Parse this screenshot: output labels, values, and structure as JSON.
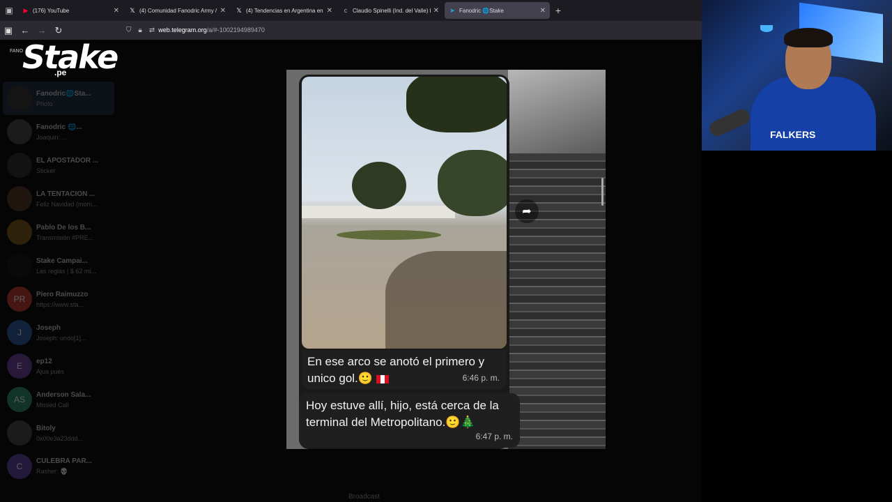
{
  "tabs": [
    {
      "title": "(176) YouTube",
      "icon": "youtube-icon",
      "active": false
    },
    {
      "title": "(4) Comunidad Fanodric Army /",
      "icon": "x-icon",
      "active": false
    },
    {
      "title": "(4) Tendencias en Argentina en",
      "icon": "x-icon",
      "active": false
    },
    {
      "title": "Claudio Spinelli (Ind. del Valle) E",
      "icon": "page-icon",
      "active": false
    },
    {
      "title": "Fanodric 🌐Stake",
      "icon": "telegram-icon",
      "active": true
    }
  ],
  "url": {
    "host": "web.telegram.org",
    "path": "/a/#-1002194989470"
  },
  "overlay": {
    "logo": "Stake",
    "logo_suffix": ".pe",
    "small_label": "FANO"
  },
  "sidebar": {
    "chats": [
      {
        "name": "Fanodric🌐Sta...",
        "preview": "Photo",
        "initials": "",
        "color": "#333"
      },
      {
        "name": "Fanodric 🌐...",
        "preview": "Joaquin: ...",
        "initials": "",
        "color": "#444"
      },
      {
        "name": "EL APOSTADOR ...",
        "preview": "Sticker",
        "initials": "",
        "color": "#2a2a2a"
      },
      {
        "name": "LA TENTACION ...",
        "preview": "Feliz Navidad (mom...",
        "initials": "",
        "color": "#553322"
      },
      {
        "name": "Pablo De los B...",
        "preview": "Transmisión #PRE...",
        "initials": "",
        "color": "#775511"
      },
      {
        "name": "Stake Campai...",
        "preview": "Las reglas | $ 62 mi...",
        "initials": "",
        "color": "#111"
      },
      {
        "name": "Piero Raimuzzo",
        "preview": "https://www.sta...",
        "initials": "PR",
        "color": "#c0392b"
      },
      {
        "name": "Joseph",
        "preview": "Joseph: undo[1]...",
        "initials": "J",
        "color": "#2c5aa0"
      },
      {
        "name": "ep12",
        "preview": "Ajua pues",
        "initials": "E",
        "color": "#6a3fa0"
      },
      {
        "name": "Anderson Sala...",
        "preview": "Missed Call",
        "initials": "AS",
        "color": "#2a8a6a"
      },
      {
        "name": "Bitoly",
        "preview": "0x00e3a23ddd...",
        "initials": "",
        "color": "#444"
      },
      {
        "name": "CULEBRA PAR...",
        "preview": "Rasher: 💀",
        "initials": "C",
        "color": "#5a3fa0"
      }
    ]
  },
  "messages": [
    {
      "text": "En ese arco se anotó el primero y unico gol.🙂",
      "time": "6:46 p. m."
    },
    {
      "text": "Hoy estuve allí, hijo, está cerca de la terminal del Metropolitano.🙂🎄",
      "time": "6:47 p. m."
    }
  ],
  "composer": {
    "placeholder": "Broadcast"
  },
  "webcam": {
    "shirt_text": "FALKERS"
  }
}
